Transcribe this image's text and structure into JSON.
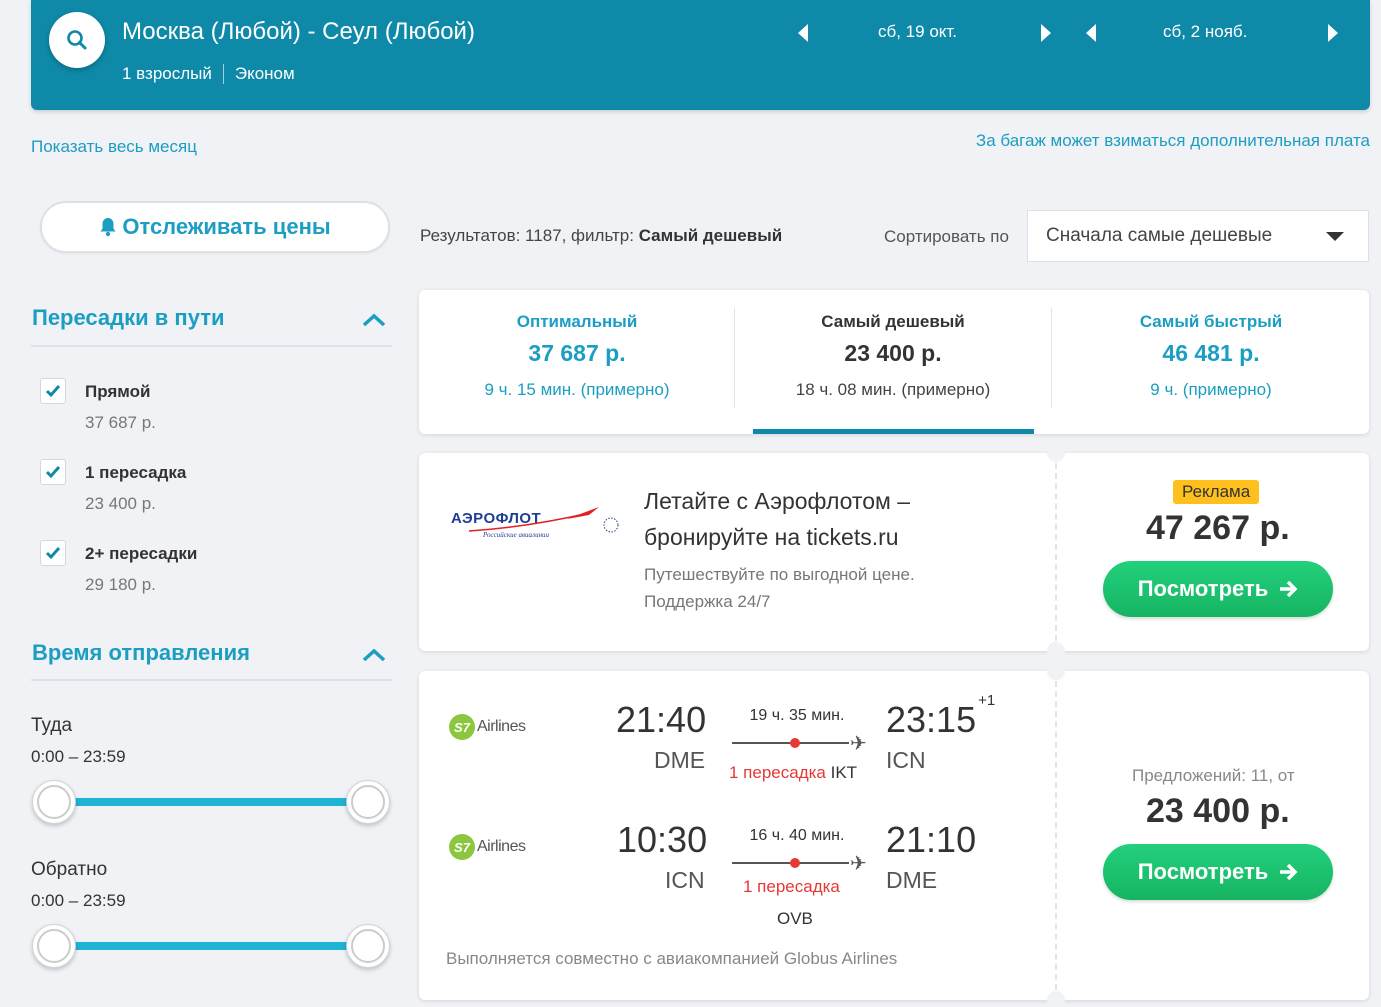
{
  "header": {
    "route": "Москва (Любой) - Сеул (Любой)",
    "passengers": "1 взрослый",
    "cabin": "Эконом",
    "depart_date": "сб, 19 окт.",
    "return_date": "сб, 2 нояб."
  },
  "show_month_link": "Показать весь месяц",
  "baggage_note": "За багаж может взиматься дополнительная плата",
  "track_prices_label": "Отслеживать цены",
  "filters": {
    "stops": {
      "title": "Пересадки в пути",
      "options": [
        {
          "label": "Прямой",
          "price": "37 687 р."
        },
        {
          "label": "1 пересадка",
          "price": "23 400 р."
        },
        {
          "label": "2+ пересадки",
          "price": "29 180 р."
        }
      ]
    },
    "departure_time": {
      "title": "Время отправления",
      "outbound_label": "Туда",
      "outbound_range": "0:00 – 23:59",
      "return_label": "Обратно",
      "return_range": "0:00 – 23:59"
    }
  },
  "results": {
    "prefix": "Результатов: 1187, фильтр: ",
    "filter": "Самый дешевый",
    "sort_label": "Сортировать по",
    "sort_value": "Сначала самые дешевые"
  },
  "tabs": [
    {
      "title": "Оптимальный",
      "price": "37 687 р.",
      "duration": "9 ч. 15 мин. (примерно)"
    },
    {
      "title": "Самый дешевый",
      "price": "23 400 р.",
      "duration": "18 ч. 08 мин. (примерно)"
    },
    {
      "title": "Самый быстрый",
      "price": "46 481 р.",
      "duration": "9 ч. (примерно)"
    }
  ],
  "ad": {
    "logo_text": "АЭРОФЛОТ",
    "logo_subtext": "Российские авиалинии",
    "title": "Летайте с Аэрофлотом – бронируйте на tickets.ru",
    "description": "Путешествуйте по выгодной цене. Поддержка 24/7",
    "badge": "Реклама",
    "price": "47 267 р.",
    "button": "Посмотреть"
  },
  "flight": {
    "outbound": {
      "airline": "Airlines",
      "depart_time": "21:40",
      "depart_code": "DME",
      "duration": "19 ч. 35 мин.",
      "arrive_time": "23:15",
      "day_offset": "+1",
      "arrive_code": "ICN",
      "transfer": "1 пересадка",
      "via": "IKT"
    },
    "inbound": {
      "airline": "Airlines",
      "depart_time": "10:30",
      "depart_code": "ICN",
      "duration": "16 ч. 40 мин.",
      "arrive_time": "21:10",
      "arrive_code": "DME",
      "transfer": "1 пересадка",
      "via": "OVB"
    },
    "operated_by": "Выполняется совместно с авиакомпанией Globus Airlines",
    "offers": "Предложений: 11, от",
    "price": "23 400 р.",
    "button": "Посмотреть"
  },
  "colors": {
    "header_bg": "#0e8aa8",
    "accent": "#1b9ec2",
    "button_green": "#16b462",
    "transfer_red": "#e53935",
    "badge_yellow": "#ffc01e"
  }
}
